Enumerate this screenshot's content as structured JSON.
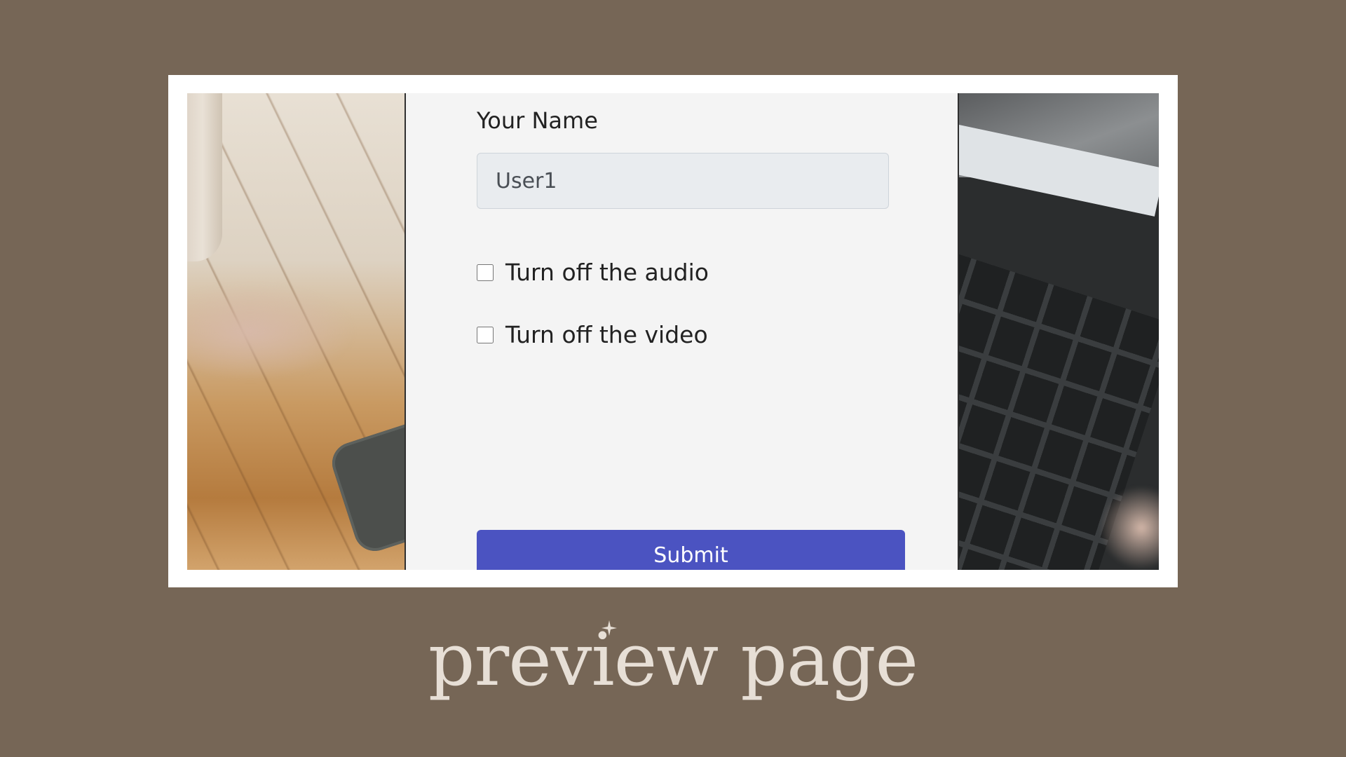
{
  "form": {
    "name_label": "Your Name",
    "name_value": "User1",
    "audio_label": "Turn off the audio",
    "video_label": "Turn off the video",
    "submit_label": "Submit"
  },
  "caption": "preview page",
  "colors": {
    "background": "#766656",
    "frame": "#ffffff",
    "form_bg": "#f4f4f4",
    "submit": "#4b53c1",
    "caption": "#e7dfd6"
  }
}
